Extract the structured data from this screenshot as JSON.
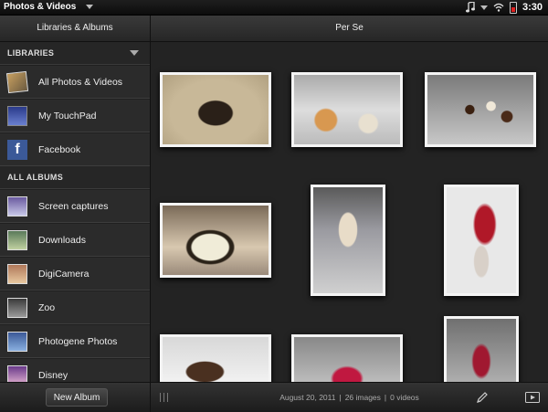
{
  "statusbar": {
    "app_menu": "Photos & Videos",
    "time": "3:30",
    "icons": [
      "music-note-icon",
      "wifi-icon",
      "battery-icon"
    ]
  },
  "left_header": {
    "title": "Libraries & Albums"
  },
  "right_header": {
    "title": "Per Se"
  },
  "sidebar": {
    "libraries_heading": "LIBRARIES",
    "libraries": [
      {
        "label": "All Photos & Videos",
        "icon": "photos-stack-icon"
      },
      {
        "label": "My TouchPad",
        "icon": "touchpad-icon"
      },
      {
        "label": "Facebook",
        "icon": "facebook-icon",
        "glyph": "f"
      }
    ],
    "albums_heading": "ALL ALBUMS",
    "albums": [
      {
        "label": "Screen captures",
        "icon": "album-thumb"
      },
      {
        "label": "Downloads",
        "icon": "album-thumb"
      },
      {
        "label": "DigiCamera",
        "icon": "album-thumb"
      },
      {
        "label": "Zoo",
        "icon": "album-thumb"
      },
      {
        "label": "Photogene Photos",
        "icon": "album-thumb"
      },
      {
        "label": "Disney",
        "icon": "album-thumb"
      }
    ]
  },
  "footer": {
    "new_album": "New Album",
    "date": "August 20, 2011",
    "images": "26 images",
    "videos": "0 videos",
    "separator": "|"
  },
  "colors": {
    "background": "#232323",
    "battery_low": "#e02020",
    "facebook": "#3b5998"
  }
}
